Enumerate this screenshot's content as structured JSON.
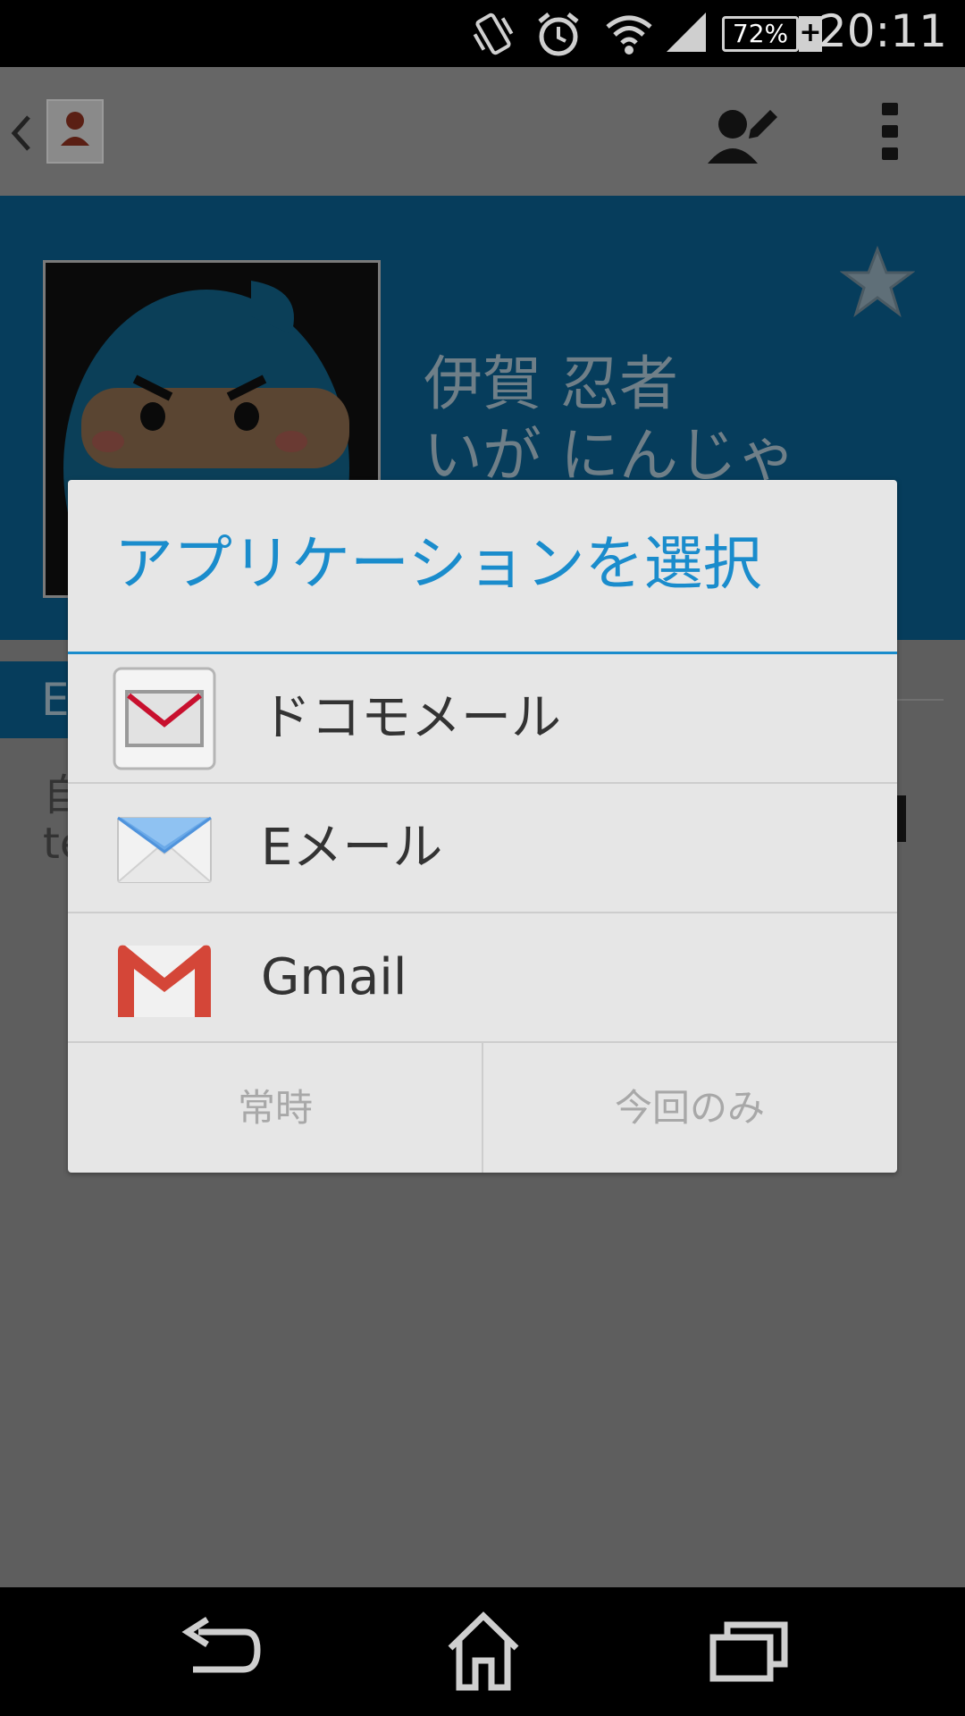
{
  "status_bar": {
    "time": "20:11",
    "battery": "72%",
    "icons": [
      "vibrate-icon",
      "alarm-icon",
      "wifi-icon",
      "signal-icon",
      "battery-icon",
      "charging-icon"
    ]
  },
  "action_bar": {
    "icons": [
      "back-chevron-icon",
      "contact-app-icon",
      "edit-contact-icon",
      "overflow-menu-icon"
    ]
  },
  "contact": {
    "name": "伊賀 忍者",
    "reading": "いが にんじゃ",
    "section_tab": "E",
    "peek_1": "自",
    "peek_2": "te"
  },
  "dialog": {
    "title": "アプリケーションを選択",
    "apps": [
      {
        "label": "ドコモメール",
        "icon": "docomo-mail-icon"
      },
      {
        "label": "Eメール",
        "icon": "email-icon"
      },
      {
        "label": "Gmail",
        "icon": "gmail-icon"
      }
    ],
    "buttons": {
      "always": "常時",
      "just_once": "今回のみ"
    }
  },
  "nav_bar": {
    "icons": [
      "back-icon",
      "home-icon",
      "recents-icon"
    ]
  },
  "colors": {
    "accent": "#1a8ccc",
    "header_bg_dimmed": "#063d5c",
    "dialog_bg": "#e6e6e6"
  }
}
